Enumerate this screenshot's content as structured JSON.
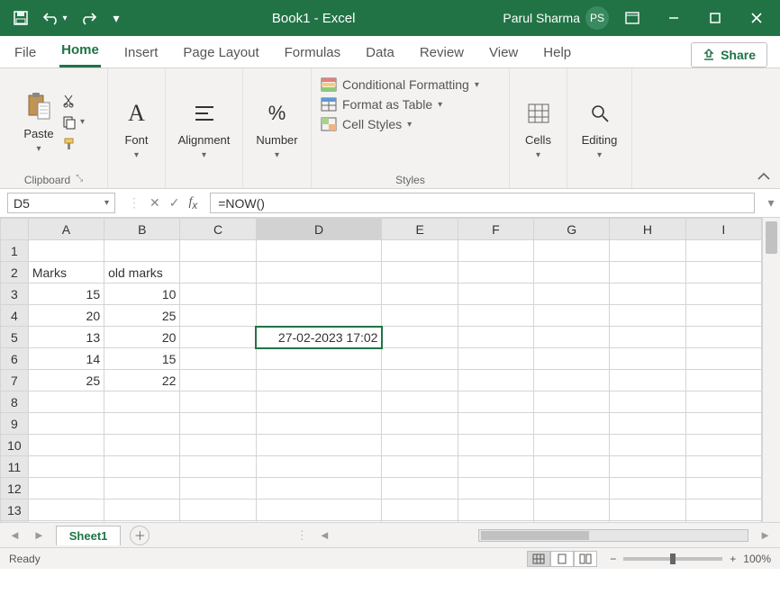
{
  "titlebar": {
    "doc_title": "Book1  -  Excel",
    "user_name": "Parul Sharma",
    "user_initials": "PS"
  },
  "tabs": {
    "file": "File",
    "home": "Home",
    "insert": "Insert",
    "page_layout": "Page Layout",
    "formulas": "Formulas",
    "data": "Data",
    "review": "Review",
    "view": "View",
    "help": "Help",
    "share": "Share"
  },
  "ribbon": {
    "clipboard": {
      "paste": "Paste",
      "label": "Clipboard"
    },
    "font": {
      "label": "Font"
    },
    "alignment": {
      "label": "Alignment"
    },
    "number": {
      "label": "Number"
    },
    "styles": {
      "cond": "Conditional Formatting",
      "table": "Format as Table",
      "cell": "Cell Styles",
      "label": "Styles"
    },
    "cells": {
      "label": "Cells"
    },
    "editing": {
      "label": "Editing"
    }
  },
  "formula_bar": {
    "name_box": "D5",
    "formula": "=NOW()"
  },
  "grid": {
    "columns": [
      "A",
      "B",
      "C",
      "D",
      "E",
      "F",
      "G",
      "H",
      "I"
    ],
    "rows_shown": 13,
    "selected_col": "D",
    "selected_row": 5,
    "data": {
      "A2": "Marks",
      "B2": "old marks",
      "A3": "15",
      "B3": "10",
      "A4": "20",
      "B4": "25",
      "A5": "13",
      "B5": "20",
      "A6": "14",
      "B6": "15",
      "A7": "25",
      "B7": "22",
      "D5": "27-02-2023 17:02"
    }
  },
  "sheet_tabs": {
    "sheet1": "Sheet1"
  },
  "statusbar": {
    "ready": "Ready",
    "zoom": "100%"
  },
  "chart_data": {
    "type": "table",
    "title": "",
    "columns": [
      "Marks",
      "old marks"
    ],
    "rows": [
      [
        15,
        10
      ],
      [
        20,
        25
      ],
      [
        13,
        20
      ],
      [
        14,
        15
      ],
      [
        25,
        22
      ]
    ]
  }
}
